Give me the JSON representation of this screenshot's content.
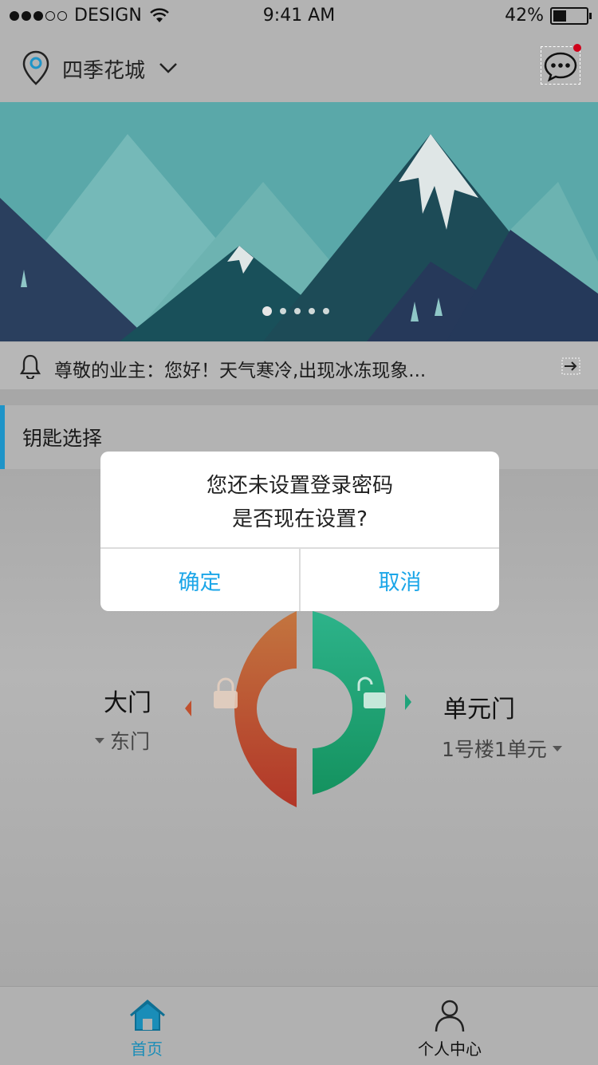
{
  "status_bar": {
    "carrier": "DESIGN",
    "time": "9:41 AM",
    "battery": "42%"
  },
  "header": {
    "location": "四季花城"
  },
  "notice": {
    "text": "尊敬的业主：您好！天气寒冷,出现冰冻现象..."
  },
  "keys": {
    "section_title": "钥匙选择",
    "left": {
      "label": "大门",
      "sub": "东门"
    },
    "right": {
      "label": "单元门",
      "sub": "1号楼1单元"
    }
  },
  "dialog": {
    "line1": "您还未设置登录密码",
    "line2": "是否现在设置?",
    "confirm": "确定",
    "cancel": "取消"
  },
  "tabs": [
    {
      "label": "首页",
      "active": true
    },
    {
      "label": "个人中心",
      "active": false
    }
  ],
  "colors": {
    "accent": "#1e94c8",
    "dialog_button": "#1ba6e8",
    "lock_red": "#c0502e",
    "lock_green": "#1fa37a"
  }
}
